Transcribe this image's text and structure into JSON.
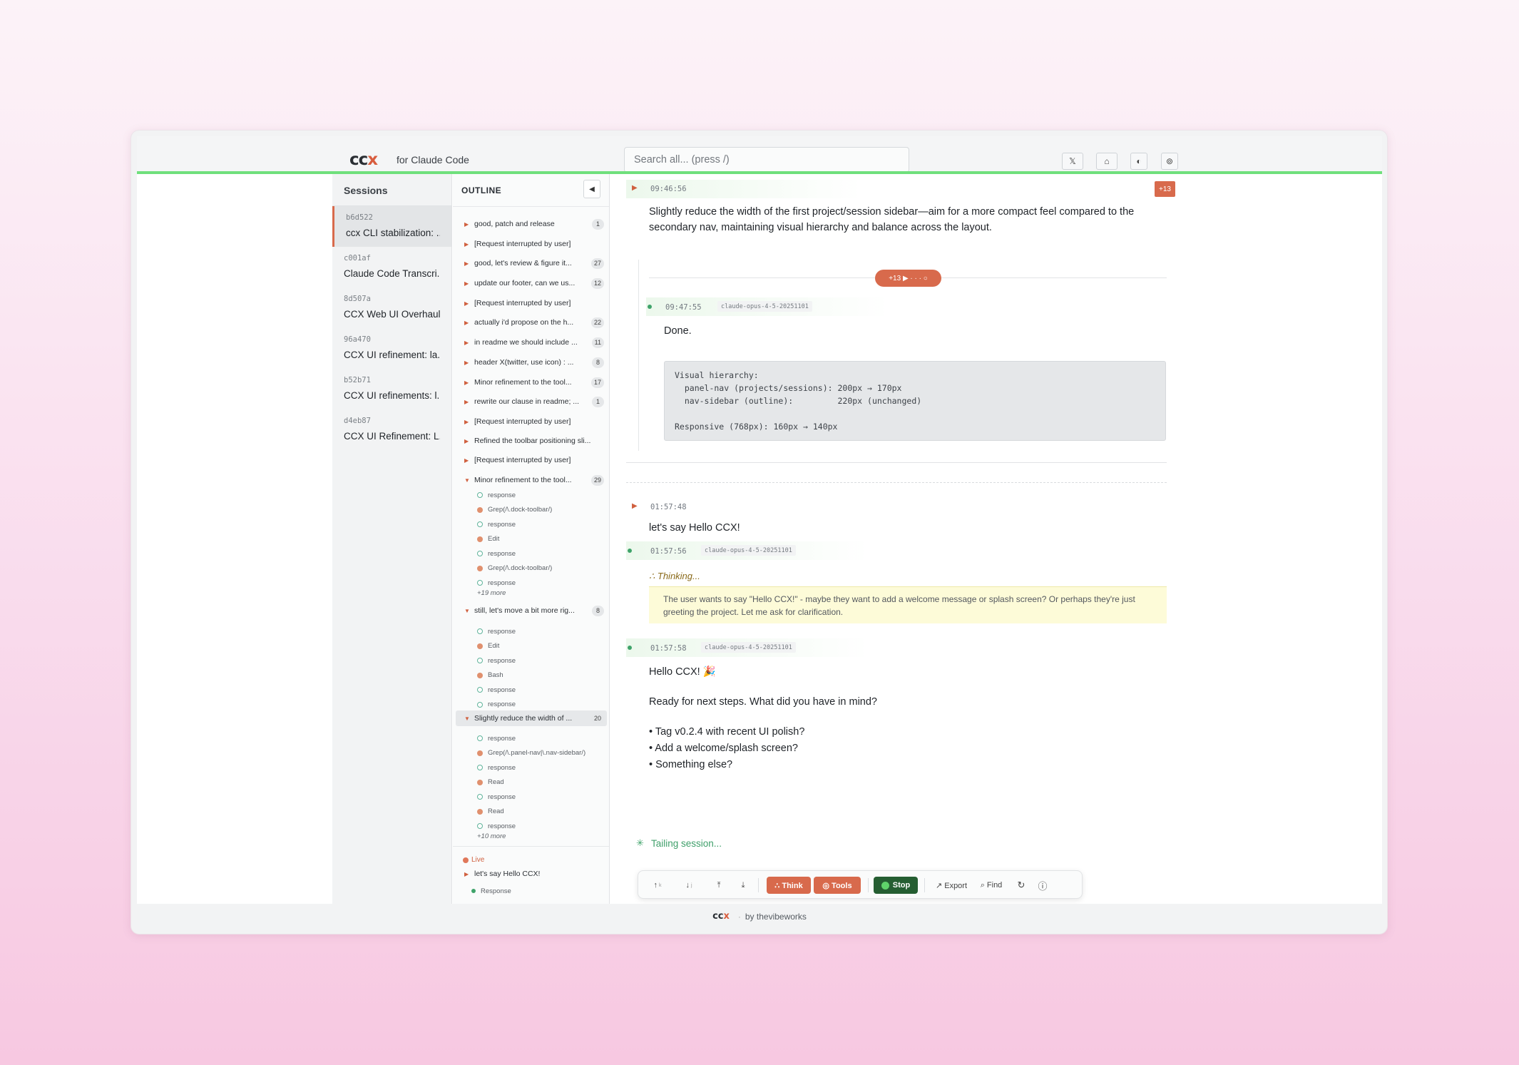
{
  "header": {
    "logo_main": "cc",
    "logo_accent": "x",
    "tagline": "for Claude Code",
    "search_placeholder": "Search all... (press /)",
    "buttons": {
      "x": "𝕏",
      "github": "⌂",
      "theme": "◐",
      "settings": "⊚"
    }
  },
  "sessions": {
    "title": "Sessions",
    "items": [
      {
        "id": "b6d522",
        "title": "ccx CLI stabilization: ..."
      },
      {
        "id": "c001af",
        "title": "Claude Code Transcri..."
      },
      {
        "id": "8d507a",
        "title": "CCX Web UI Overhaul..."
      },
      {
        "id": "96a470",
        "title": "CCX UI refinement: la..."
      },
      {
        "id": "b52b71",
        "title": "CCX UI refinements: l..."
      },
      {
        "id": "d4eb87",
        "title": "CCX UI Refinement: L..."
      }
    ]
  },
  "outline": {
    "title": "OUTLINE",
    "collapse": "◀",
    "items": [
      {
        "label": "good, patch and release",
        "count": "1"
      },
      {
        "label": "[Request interrupted by user]",
        "count": ""
      },
      {
        "label": "good, let's review & figure it...",
        "count": "27"
      },
      {
        "label": "update our footer, can we us...",
        "count": "12"
      },
      {
        "label": "[Request interrupted by user]",
        "count": ""
      },
      {
        "label": "actually i'd propose on the h...",
        "count": "22"
      },
      {
        "label": "in readme we should include ...",
        "count": "11"
      },
      {
        "label": "header X(twitter, use icon) : ...",
        "count": "8"
      },
      {
        "label": "Minor refinement to the tool...",
        "count": "17"
      },
      {
        "label": "rewrite our clause in readme; ...",
        "count": "1"
      },
      {
        "label": "[Request interrupted by user]",
        "count": ""
      },
      {
        "label": "Refined the toolbar positioning sli...",
        "count": ""
      },
      {
        "label": "[Request interrupted by user]",
        "count": ""
      },
      {
        "label": "Minor refinement to the tool...",
        "count": "29"
      },
      {
        "label": "still, let's move a bit more rig...",
        "count": "8"
      },
      {
        "label": "Slightly reduce the width of ...",
        "count": "20"
      }
    ],
    "group1": [
      "response",
      "Grep(/\\.dock-toolbar/)",
      "response",
      "Edit",
      "response",
      "Grep(/\\.dock-toolbar/)",
      "response"
    ],
    "group1_more": "+19 more",
    "group2": [
      "response",
      "Edit",
      "response",
      "Bash",
      "response",
      "response"
    ],
    "group3": [
      "response",
      "Grep(/\\.panel-nav|\\.nav-sidebar/)",
      "response",
      "Read",
      "response",
      "Read",
      "response"
    ],
    "group3_more": "+10 more",
    "live_label": "Live",
    "live_item": "let's say Hello CCX!",
    "live_sub": "Response"
  },
  "main": {
    "m1_time": "09:46:56",
    "m1_badge": "+13",
    "m1_text": "Slightly reduce the width of the first project/session sidebar—aim for a more compact feel compared to the secondary nav, maintaining visual hierarchy and balance across the layout.",
    "collapsed_pill": "+13 ▶ · · · ○",
    "m2_time": "09:47:55",
    "m2_model": "claude-opus-4-5-20251101",
    "m2_text": "Done.",
    "code": "Visual hierarchy:\n  panel-nav (projects/sessions): 200px → 170px\n  nav-sidebar (outline):         220px (unchanged)\n\nResponsive (768px): 160px → 140px",
    "m3_time": "01:57:48",
    "m3_text": "let's say Hello CCX!",
    "m4_time": "01:57:56",
    "m4_model": "claude-opus-4-5-20251101",
    "thinking_label": "∴ Thinking...",
    "thinking_text": "The user wants to say \"Hello CCX!\" - maybe they want to add a welcome message or splash screen? Or perhaps they're just greeting the project. Let me ask for clarification.",
    "m5_time": "01:57:58",
    "m5_model": "claude-opus-4-5-20251101",
    "m5_line1": "Hello CCX! 🎉",
    "m5_line2": "Ready for next steps. What did you have in mind?",
    "m5_bullets": [
      "• Tag v0.2.4 with recent UI polish?",
      "• Add a welcome/splash screen?",
      "• Something else?"
    ],
    "tailing": "Tailing session..."
  },
  "toolbar": {
    "up": "↑",
    "up_key": "k",
    "down": "↓",
    "down_key": "j",
    "top": "⤒",
    "bottom": "⤓",
    "think": "∴ Think",
    "tools": "◎ Tools",
    "stop": "Stop",
    "export": "↗ Export",
    "find": "⌕ Find",
    "refresh": "↻",
    "info": "ⓘ"
  },
  "footer": {
    "logo_main": "cc",
    "logo_accent": "x",
    "sep": "·",
    "by": "by thevibeworks"
  },
  "colors": {
    "accent": "#d86a4c",
    "live_green": "#6fe07c",
    "stop_green": "#255e32"
  }
}
